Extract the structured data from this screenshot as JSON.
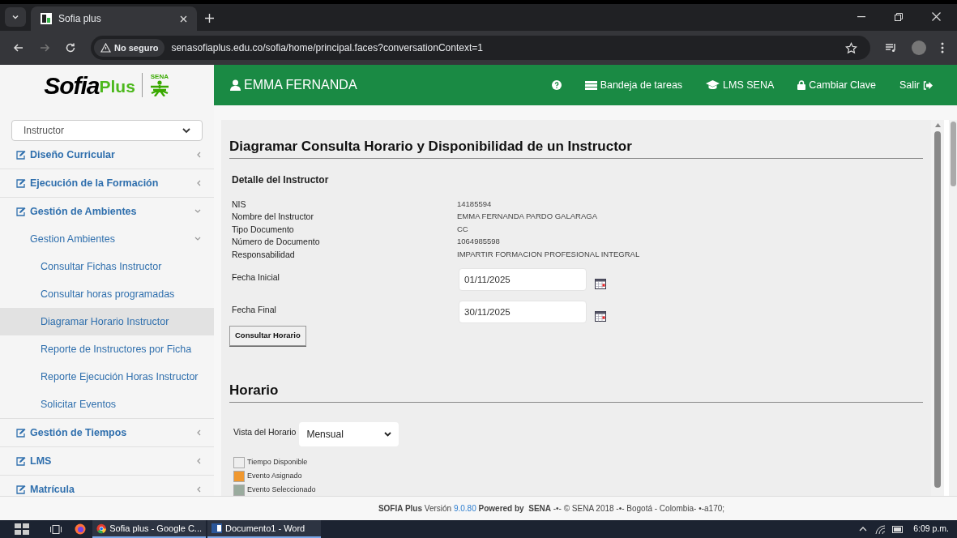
{
  "browser": {
    "tab_title": "Sofia plus",
    "security": "No seguro",
    "url": "senasofiaplus.edu.co/sofia/home/principal.faces?conversationContext=1"
  },
  "header": {
    "logo": {
      "word1": "Sofia",
      "word2": "Plus",
      "mark": "SENA"
    },
    "user": "EMMA FERNANDA",
    "nav": [
      {
        "kind": "help"
      },
      {
        "kind": "tasks",
        "label": "Bandeja de tareas"
      },
      {
        "kind": "cap",
        "label": "LMS SENA"
      },
      {
        "kind": "lock",
        "label": "Cambiar Clave"
      },
      {
        "kind": "exit",
        "label": "Salir"
      }
    ]
  },
  "sidebar": {
    "role": "Instructor",
    "items": [
      {
        "label": "Diseño Curricular",
        "expanded": false
      },
      {
        "label": "Ejecución de la Formación",
        "expanded": false
      },
      {
        "label": "Gestión de Ambientes",
        "expanded": true,
        "children": [
          {
            "label": "Gestion Ambientes",
            "expanded": true,
            "children": [
              {
                "label": "Consultar Fichas Instructor",
                "selected": false
              },
              {
                "label": "Consultar horas programadas",
                "selected": false
              },
              {
                "label": "Diagramar Horario Instructor",
                "selected": true
              },
              {
                "label": "Reporte de Instructores por Ficha",
                "selected": false
              },
              {
                "label": "Reporte Ejecución Horas Instructor",
                "selected": false
              },
              {
                "label": "Solicitar Eventos",
                "selected": false
              }
            ]
          }
        ]
      },
      {
        "label": "Gestión de Tiempos",
        "expanded": false
      },
      {
        "label": "LMS",
        "expanded": false
      },
      {
        "label": "Matrícula",
        "expanded": false
      }
    ]
  },
  "content": {
    "title": "Diagramar Consulta Horario y Disponibilidad de un Instructor",
    "section": "Detalle del Instructor",
    "details": [
      {
        "label": "NIS",
        "value": "14185594"
      },
      {
        "label": "Nombre del Instructor",
        "value": "EMMA FERNANDA PARDO GALARAGA"
      },
      {
        "label": "Tipo Documento",
        "value": "CC"
      },
      {
        "label": "Número de Documento",
        "value": "1064985598"
      },
      {
        "label": "Responsabilidad",
        "value": "IMPARTIR FORMACION PROFESIONAL INTEGRAL"
      }
    ],
    "dates": [
      {
        "label": "Fecha Inicial",
        "value": "01/11/2025"
      },
      {
        "label": "Fecha Final",
        "value": "30/11/2025"
      }
    ],
    "button": "Consultar Horario",
    "schedule_title": "Horario",
    "view_label": "Vista del Horario",
    "view_value": "Mensual",
    "legend": [
      {
        "label": "Tiempo Disponible",
        "color": "#eeeeee"
      },
      {
        "label": "Evento Asignado",
        "color": "#f0982f"
      },
      {
        "label": "Evento Seleccionado",
        "color": "#9aab9e"
      }
    ]
  },
  "footer": {
    "brand": "SOFIA Plus",
    "version_label": "Versión",
    "version": "9.0.80",
    "powered": "Powered by  SENA",
    "rest": "-•- © SENA 2018 -•- Bogotá - Colombia- •-a170;"
  },
  "taskbar": {
    "apps": [
      {
        "kind": "chrome",
        "label": "Sofia plus - Google C..."
      },
      {
        "kind": "word",
        "label": "Documento1 - Word"
      }
    ],
    "clock": "6:09 p.m."
  }
}
